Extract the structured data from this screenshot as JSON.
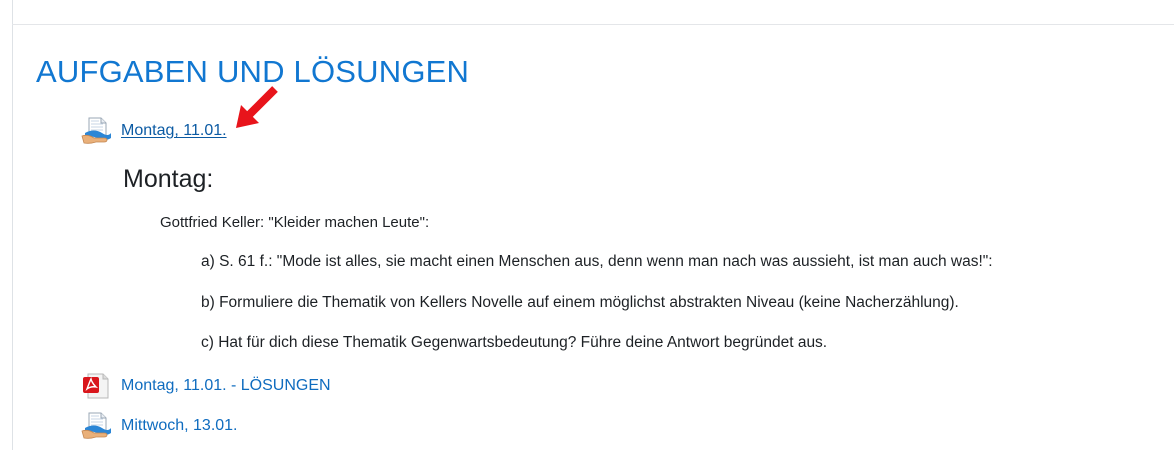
{
  "section": {
    "title": "AUFGABEN UND LÖSUNGEN"
  },
  "activities": [
    {
      "label": "Montag, 11.01.",
      "icon": "page-icon"
    },
    {
      "label": "Montag, 11.01. - LÖSUNGEN",
      "icon": "pdf-icon"
    },
    {
      "label": "Mittwoch, 13.01.",
      "icon": "page-icon"
    }
  ],
  "summary": {
    "heading": "Montag:",
    "intro": "Gottfried Keller: \"Kleider machen Leute\":",
    "tasks": [
      "a) S. 61 f.: \"Mode ist alles, sie macht einen Menschen aus, denn wenn man nach was aussieht, ist man auch was!\":",
      "b) Formuliere die Thematik von Kellers Novelle auf einem möglichst abstrakten Niveau (keine Nacherzählung).",
      "c) Hat für dich diese Thematik Gegenwartsbedeutung? Führe deine Antwort begründet aus."
    ]
  },
  "annotation": {
    "icon": "red-arrow-icon",
    "color": "#e8141b"
  },
  "colors": {
    "accent": "#1177d1",
    "link": "#0f6cbf",
    "text": "#1d2125"
  }
}
